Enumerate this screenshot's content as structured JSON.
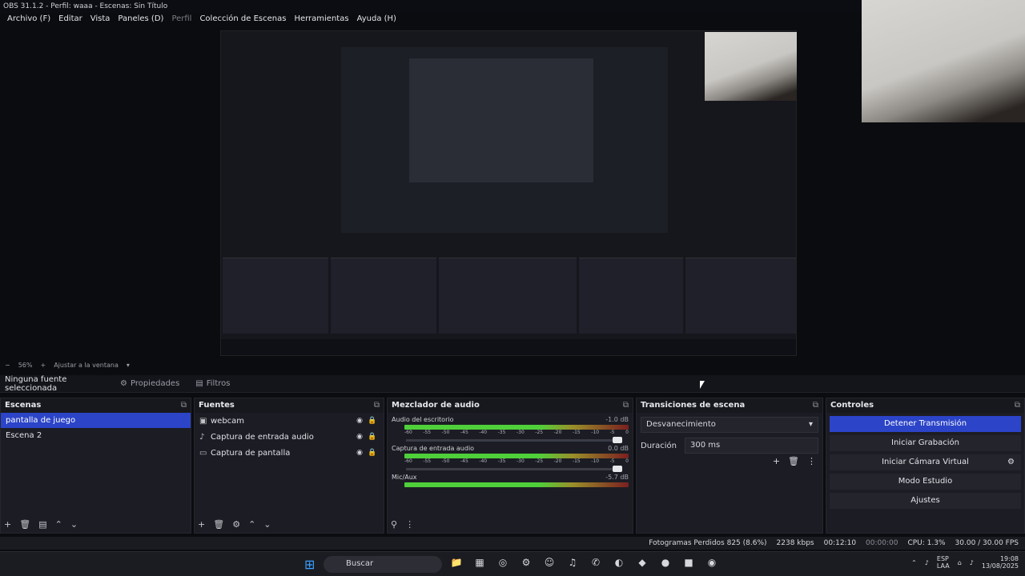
{
  "window": {
    "title": "OBS 31.1.2 - Perfil: waaa - Escenas: Sin Título"
  },
  "menu": {
    "items": [
      "Archivo (F)",
      "Editar",
      "Vista",
      "Paneles (D)",
      "Perfil",
      "Colección de Escenas",
      "Herramientas",
      "Ayuda (H)"
    ]
  },
  "zoom": {
    "percent": "56%",
    "fit": "Ajustar a la ventana"
  },
  "source_bar": {
    "none": "Ninguna fuente seleccionada",
    "properties": "Propiedades",
    "filters": "Filtros"
  },
  "scenes": {
    "title": "Escenas",
    "items": [
      "pantalla de juego",
      "Escena 2"
    ]
  },
  "sources": {
    "title": "Fuentes",
    "items": [
      "webcam",
      "Captura de entrada audio",
      "Captura de pantalla"
    ]
  },
  "mixer": {
    "title": "Mezclador de audio",
    "tracks": [
      {
        "name": "Audio del escritorio",
        "db": "-1.0 dB"
      },
      {
        "name": "Captura de entrada audio",
        "db": "0.0 dB"
      },
      {
        "name": "Mic/Aux",
        "db": "-5.7 dB"
      }
    ],
    "scale": [
      "-60",
      "-55",
      "-50",
      "-45",
      "-40",
      "-35",
      "-30",
      "-25",
      "-20",
      "-15",
      "-10",
      "-5",
      "0"
    ]
  },
  "transitions": {
    "title": "Transiciones de escena",
    "type": "Desvanecimiento",
    "duration_label": "Duración",
    "duration_value": "300 ms"
  },
  "controls": {
    "title": "Controles",
    "stream": "Detener Transmisión",
    "record": "Iniciar Grabación",
    "vcam": "Iniciar Cámara Virtual",
    "studio": "Modo Estudio",
    "settings": "Ajustes"
  },
  "status": {
    "dropped": "Fotogramas Perdidos 825 (8.6%)",
    "bitrate": "2238 kbps",
    "stream_time": "00:12:10",
    "rec_time": "00:00:00",
    "cpu": "CPU: 1.3%",
    "fps": "30.00 / 30.00 FPS"
  },
  "taskbar": {
    "search": "Buscar",
    "lang1": "ESP",
    "lang2": "LAA",
    "time": "19:08",
    "date": "13/08/2025"
  }
}
